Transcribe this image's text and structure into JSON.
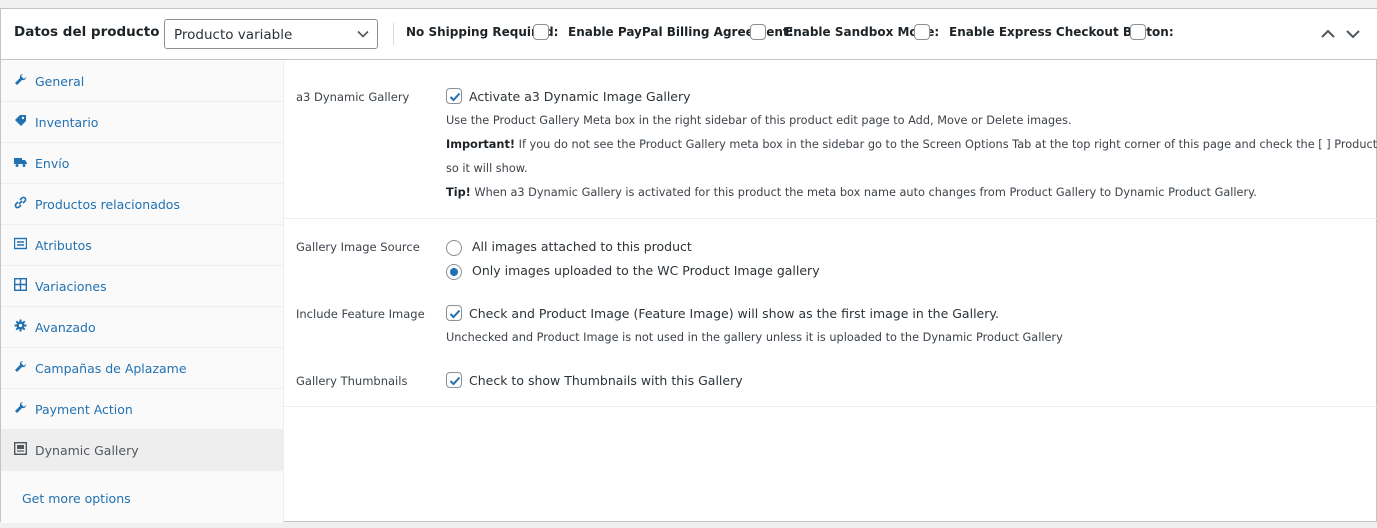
{
  "header": {
    "title": "Datos del producto —",
    "product_type": "Producto variable",
    "options": [
      {
        "label": "No Shipping Required:",
        "checked": false
      },
      {
        "label": "Enable PayPal Billing Agreement:",
        "checked": false
      },
      {
        "label": "Enable Sandbox Mode:",
        "checked": false
      },
      {
        "label": "Enable Express Checkout Button:",
        "checked": false
      }
    ]
  },
  "sidebar": {
    "items": [
      {
        "label": "General",
        "icon": "wrench-icon"
      },
      {
        "label": "Inventario",
        "icon": "tag-icon"
      },
      {
        "label": "Envío",
        "icon": "truck-icon"
      },
      {
        "label": "Productos relacionados",
        "icon": "link-icon"
      },
      {
        "label": "Atributos",
        "icon": "list-icon"
      },
      {
        "label": "Variaciones",
        "icon": "grid-icon"
      },
      {
        "label": "Avanzado",
        "icon": "gear-icon"
      },
      {
        "label": "Campañas de Aplazame",
        "icon": "wrench-icon"
      },
      {
        "label": "Payment Action",
        "icon": "wrench-icon"
      },
      {
        "label": "Dynamic Gallery",
        "icon": "gallery-icon",
        "active": true
      }
    ],
    "get_more": "Get more options"
  },
  "gallery": {
    "a3": {
      "label": "a3 Dynamic Gallery",
      "checkbox_label": "Activate a3 Dynamic Image Gallery",
      "checked": true,
      "desc1": "Use the Product Gallery Meta box in the right sidebar of this product edit page to Add, Move or Delete images.",
      "important_label": "Important!",
      "important_text": " If you do not see the Product Gallery meta box in the sidebar go to the Screen Options Tab at the top right corner of this page and check the [ ] Product Gallery box",
      "important_text2": "so it will show.",
      "tip_label": "Tip!",
      "tip_text": " When a3 Dynamic Gallery is activated for this product the meta box name auto changes from Product Gallery to Dynamic Product Gallery."
    },
    "source": {
      "label": "Gallery Image Source",
      "options": [
        {
          "label": "All images attached to this product",
          "selected": false
        },
        {
          "label": "Only images uploaded to the WC Product Image gallery",
          "selected": true
        }
      ]
    },
    "feature": {
      "label": "Include Feature Image",
      "checkbox_label": "Check and Product Image (Feature Image) will show as the first image in the Gallery.",
      "checked": true,
      "desc": "Unchecked and Product Image is not used in the gallery unless it is uploaded to the Dynamic Product Gallery"
    },
    "thumbs": {
      "label": "Gallery Thumbnails",
      "checkbox_label": "Check to show Thumbnails with this Gallery",
      "checked": true
    }
  },
  "colors": {
    "link": "#2271b1",
    "border": "#c3c4c7",
    "active_tab": "#eeeeee"
  }
}
